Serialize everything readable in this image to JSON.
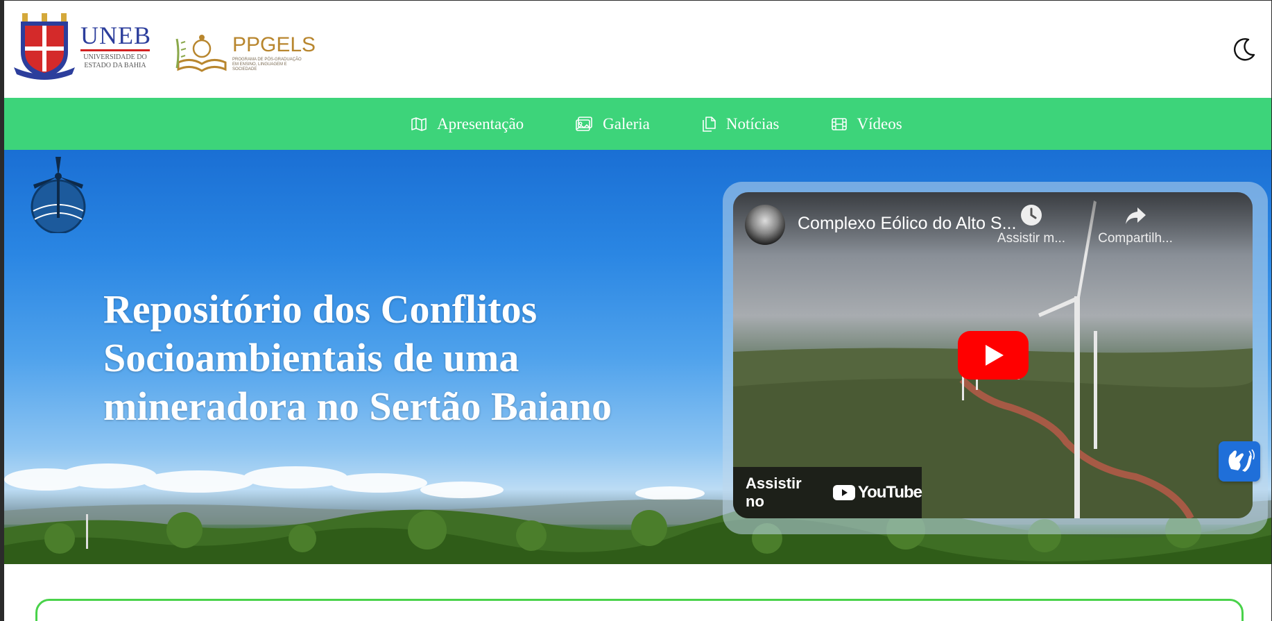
{
  "header": {
    "uneb_logo": {
      "name": "UNEB",
      "subtitle": "UNIVERSIDADE DO ESTADO DA BAHIA"
    },
    "ppgels_logo": {
      "name": "PPGELS",
      "subtitle": "PROGRAMA DE PÓS-GRADUAÇÃO EM ENSINO, LINGUAGEM E SOCIEDADE"
    },
    "theme_toggle_icon": "moon-icon"
  },
  "nav": {
    "items": [
      {
        "label": "Apresentação",
        "icon": "map-icon"
      },
      {
        "label": "Galeria",
        "icon": "image-icon"
      },
      {
        "label": "Notícias",
        "icon": "documents-icon"
      },
      {
        "label": "Vídeos",
        "icon": "film-icon"
      }
    ]
  },
  "hero": {
    "title": "Repositório dos Conflitos Socioambientais de uma mineradora no Sertão Baiano"
  },
  "video": {
    "title": "Complexo Eólico do Alto S...",
    "watch_later": "Assistir m...",
    "share": "Compartilh...",
    "watch_on": "Assistir no",
    "platform": "YouTube"
  },
  "colors": {
    "nav_bg": "#3dd47a",
    "card_border": "#49d24a",
    "accessibility_button": "#1f6fd9"
  }
}
